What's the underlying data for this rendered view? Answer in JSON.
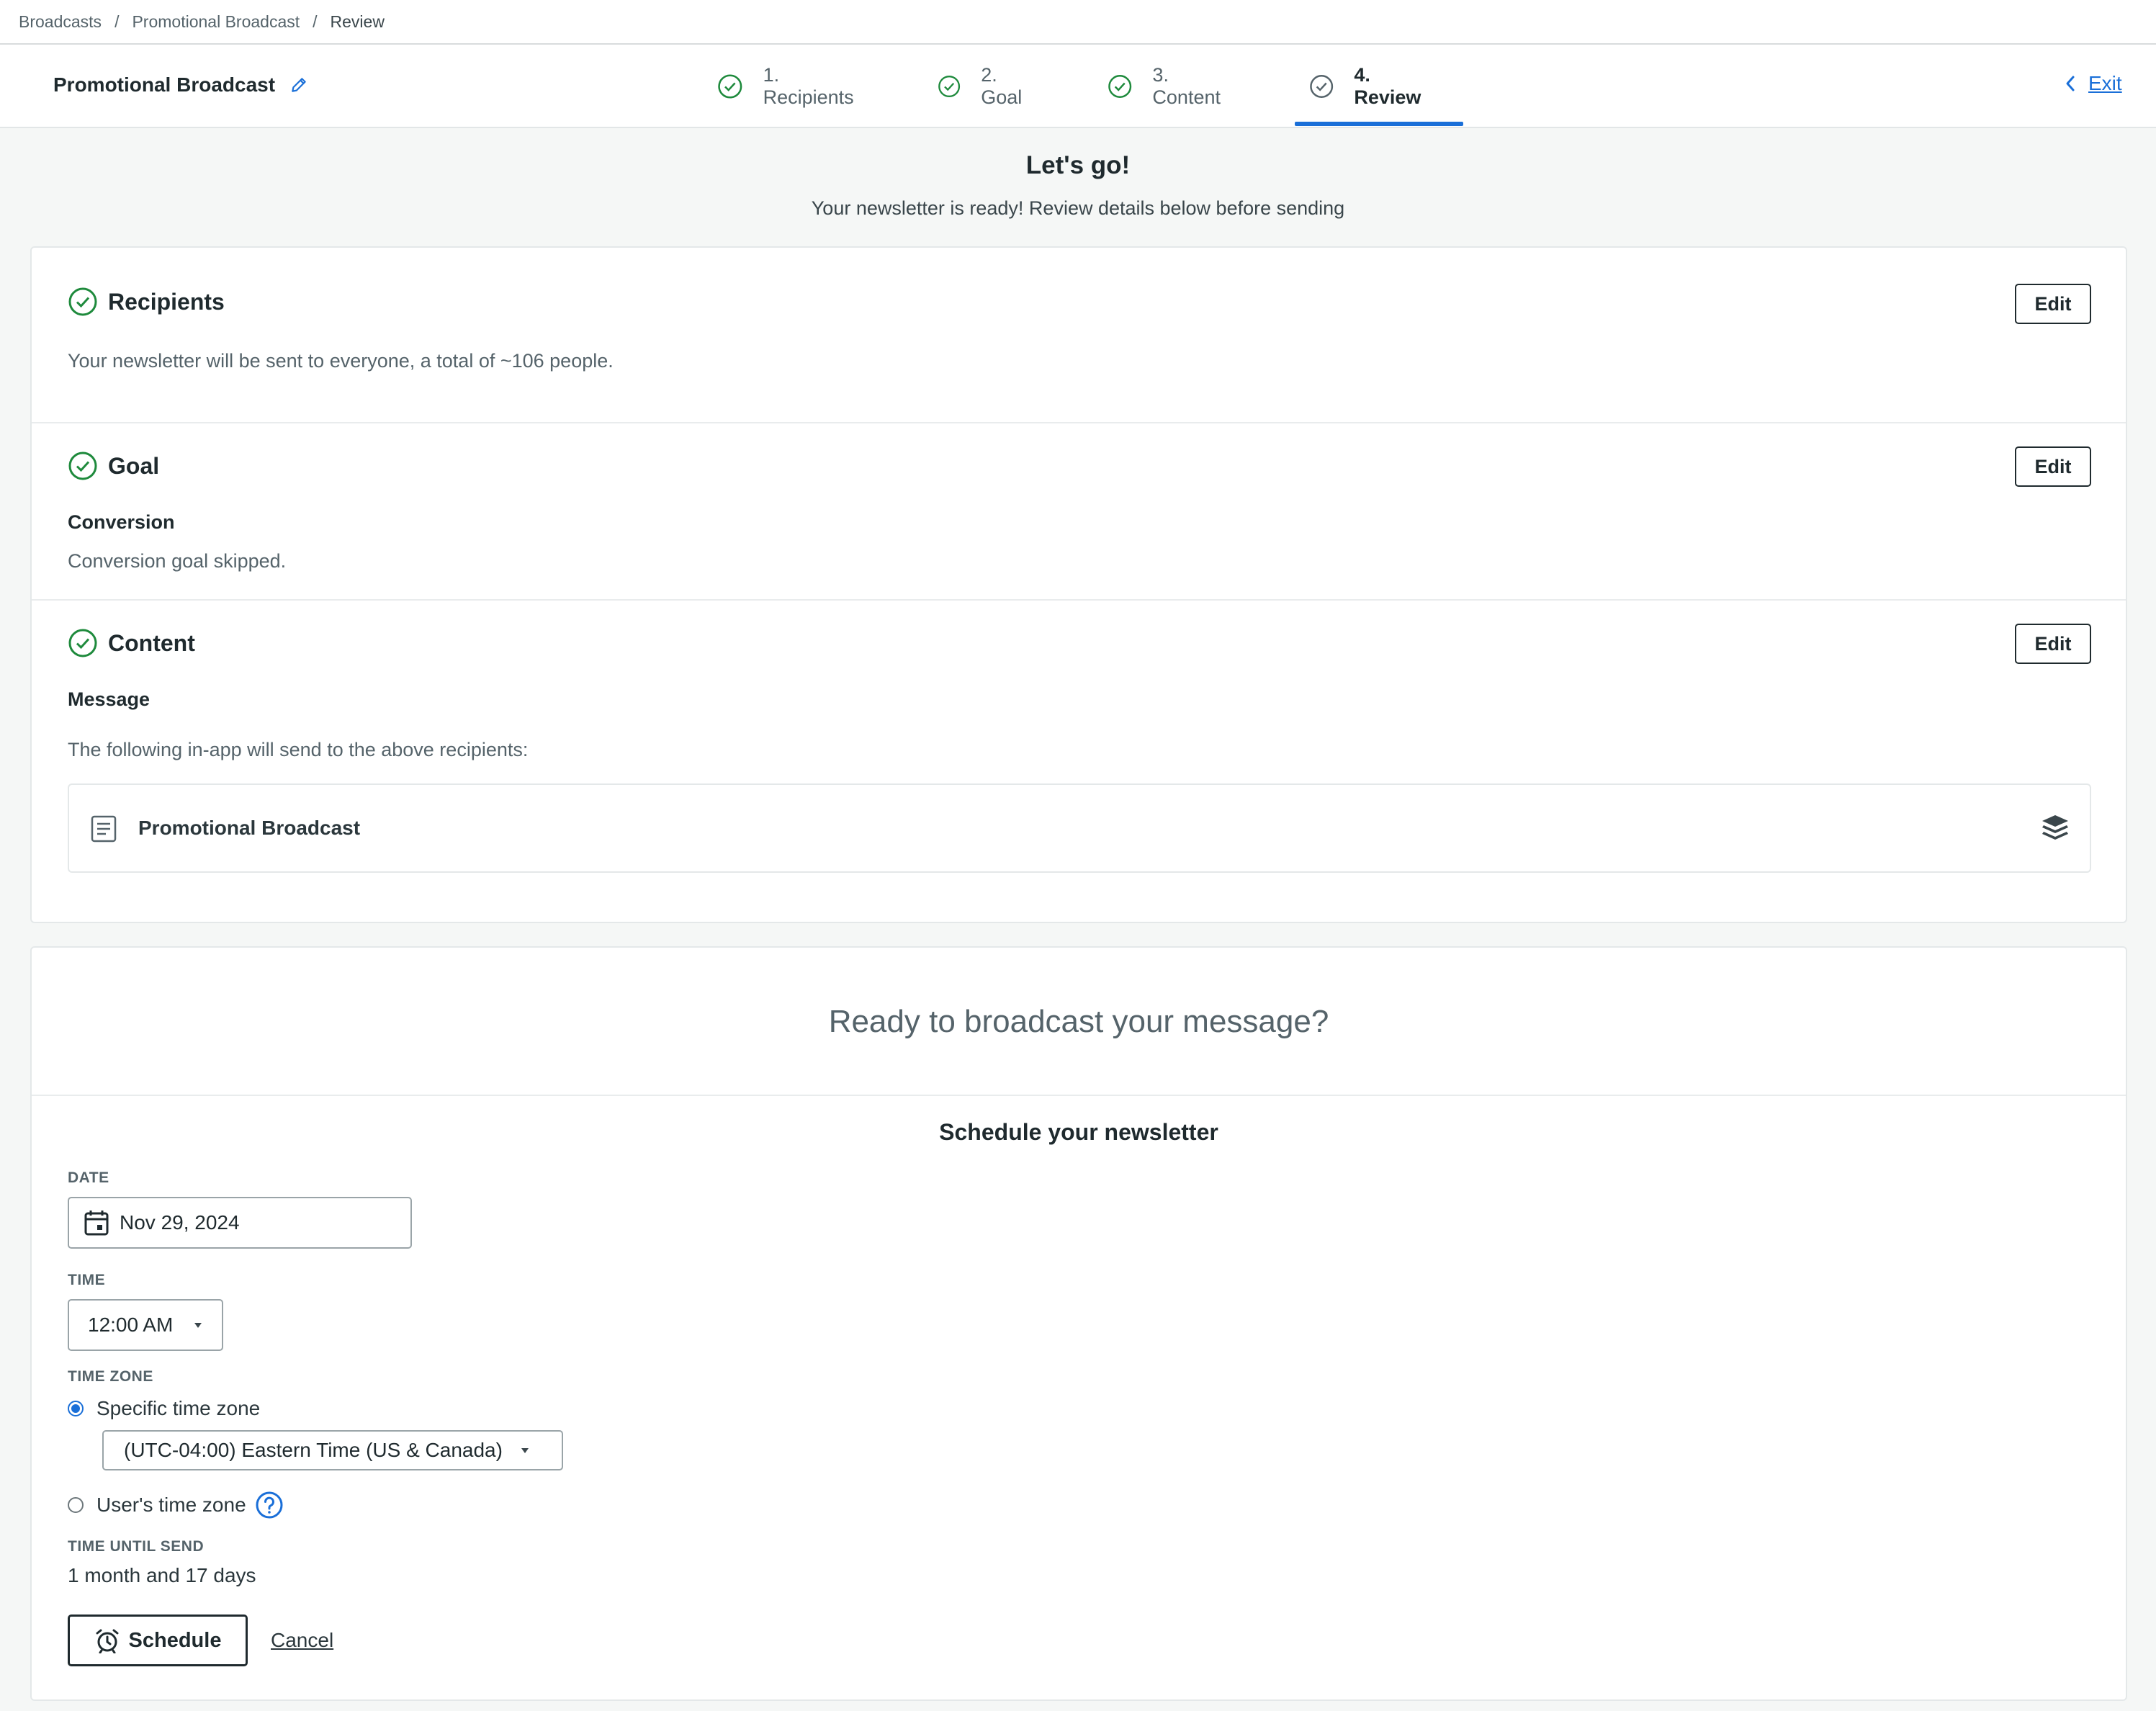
{
  "breadcrumb": {
    "items": [
      "Broadcasts",
      "Promotional Broadcast",
      "Review"
    ],
    "separator": "/"
  },
  "header": {
    "title": "Promotional Broadcast",
    "steps": [
      {
        "label": "1. Recipients",
        "state": "complete"
      },
      {
        "label": "2. Goal",
        "state": "complete"
      },
      {
        "label": "3. Content",
        "state": "complete"
      },
      {
        "label": "4. Review",
        "state": "active"
      }
    ],
    "exit_label": "Exit"
  },
  "hero": {
    "title": "Let's go!",
    "subtitle": "Your newsletter is ready! Review details below before sending"
  },
  "review": {
    "recipients": {
      "title": "Recipients",
      "edit_label": "Edit",
      "description": "Your newsletter will be sent to everyone, a total of ~106 people."
    },
    "goal": {
      "title": "Goal",
      "edit_label": "Edit",
      "subheading": "Conversion",
      "description": "Conversion goal skipped."
    },
    "content": {
      "title": "Content",
      "edit_label": "Edit",
      "subheading": "Message",
      "description": "The following in-app will send to the above recipients:",
      "message_name": "Promotional Broadcast"
    }
  },
  "schedule": {
    "ready_text": "Ready to broadcast your message?",
    "title": "Schedule your newsletter",
    "date_label": "DATE",
    "date_value": "Nov 29, 2024",
    "time_label": "TIME",
    "time_value": "12:00 AM",
    "timezone_label": "TIME ZONE",
    "specific_tz_label": "Specific time zone",
    "specific_tz_value": "(UTC-04:00) Eastern Time (US & Canada)",
    "user_tz_label": "User's time zone",
    "time_until_label": "TIME UNTIL SEND",
    "time_until_value": "1 month and 17 days",
    "schedule_button": "Schedule",
    "cancel_label": "Cancel"
  },
  "colors": {
    "accent": "#1a6fd8",
    "success": "#1e8a3c",
    "text": "#1f2a2e",
    "muted": "#55636a"
  }
}
